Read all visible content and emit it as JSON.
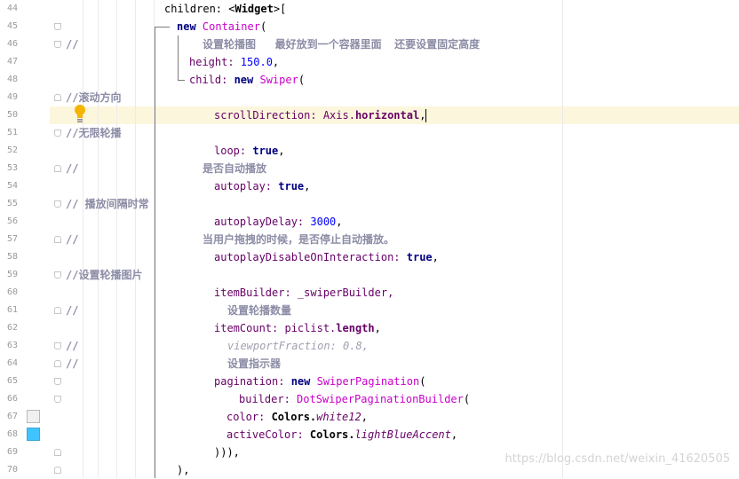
{
  "line_numbers": [
    "44",
    "45",
    "46",
    "47",
    "48",
    "49",
    "50",
    "51",
    "52",
    "53",
    "54",
    "55",
    "56",
    "57",
    "58",
    "59",
    "60",
    "61",
    "62",
    "63",
    "64",
    "65",
    "66",
    "67",
    "68",
    "69",
    "70"
  ],
  "code": {
    "l44": {
      "a": "children: <",
      "b": "Widget",
      "c": ">["
    },
    "l45": {
      "kw": "new ",
      "cls": "Container",
      "rest": "("
    },
    "l46": {
      "slashes": "//",
      "comment": "设置轮播图   最好放到一个容器里面  还要设置固定高度"
    },
    "l47": {
      "prop": "height: ",
      "num": "150.0",
      ",": ","
    },
    "l48": {
      "prop": "child: ",
      "kw": "new ",
      "cls": "Swiper",
      "rest": "("
    },
    "l49": {
      "comment": "//滚动方向"
    },
    "l50": {
      "prop": "scrollDirection: Axis.",
      "bold": "horizontal",
      ",": ","
    },
    "l51": {
      "comment": "//无限轮播"
    },
    "l52": {
      "prop": "loop: ",
      "kw": "true",
      ",": ","
    },
    "l53": {
      "slashes": "//",
      "comment": "是否自动播放"
    },
    "l54": {
      "prop": "autoplay: ",
      "kw": "true",
      ",": ","
    },
    "l55": {
      "comment": "// 播放间隔时常"
    },
    "l56": {
      "prop": "autoplayDelay: ",
      "num": "3000",
      ",": ","
    },
    "l57": {
      "slashes": "//",
      "comment": "当用户拖拽的时候，是否停止自动播放。"
    },
    "l58": {
      "prop": "autoplayDisableOnInteraction: ",
      "kw": "true",
      ",": ","
    },
    "l59": {
      "comment": "//设置轮播图片"
    },
    "l60": {
      "prop": "itemBuilder: _swiperBuilder,"
    },
    "l61": {
      "slashes": "//",
      "comment": "设置轮播数量"
    },
    "l62": {
      "prop": "itemCount: piclist.",
      "bold": "length",
      ",": ","
    },
    "l63": {
      "slashes": "//",
      "hint": "viewportFraction: 0.8,"
    },
    "l64": {
      "slashes": "//",
      "comment": "设置指示器"
    },
    "l65": {
      "prop": "pagination: ",
      "kw": "new ",
      "cls": "SwiperPagination",
      "rest": "("
    },
    "l66": {
      "prop": "builder: ",
      "cls": "DotSwiperPaginationBuilder",
      "rest": "("
    },
    "l67": {
      "prop": "color: ",
      "bold": "Colors.",
      "ital": "white12",
      ",": ","
    },
    "l68": {
      "prop": "activeColor: ",
      "bold": "Colors.",
      "ital": "lightBlueAccent",
      ",": ","
    },
    "l69": {
      "text": "))),"
    },
    "l70": {
      "text": "),"
    }
  },
  "swatches": {
    "white12": "#f0f0f0",
    "lightBlueAccent": "#40c4ff"
  },
  "icons": {
    "intention": "lightbulb-icon"
  },
  "watermark": "https://blog.csdn.net/weixin_41620505"
}
